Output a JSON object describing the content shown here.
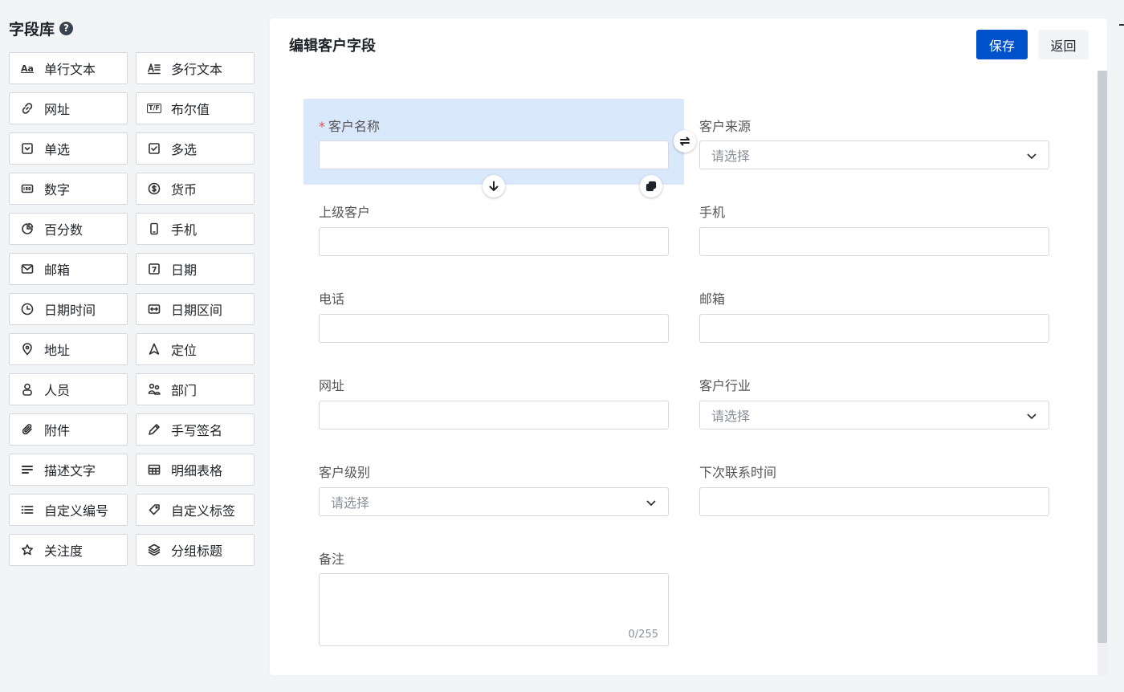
{
  "library": {
    "title": "字段库",
    "items": [
      {
        "label": "单行文本",
        "icon": "text-aa-icon"
      },
      {
        "label": "多行文本",
        "icon": "text-multiline-icon"
      },
      {
        "label": "网址",
        "icon": "link-icon"
      },
      {
        "label": "布尔值",
        "icon": "boolean-tf-icon"
      },
      {
        "label": "单选",
        "icon": "single-select-icon"
      },
      {
        "label": "多选",
        "icon": "multi-select-icon"
      },
      {
        "label": "数字",
        "icon": "number-100-icon"
      },
      {
        "label": "货币",
        "icon": "currency-dollar-icon"
      },
      {
        "label": "百分数",
        "icon": "pie-percent-icon"
      },
      {
        "label": "手机",
        "icon": "phone-icon"
      },
      {
        "label": "邮箱",
        "icon": "mail-icon"
      },
      {
        "label": "日期",
        "icon": "calendar-icon"
      },
      {
        "label": "日期时间",
        "icon": "clock-icon"
      },
      {
        "label": "日期区间",
        "icon": "date-range-icon"
      },
      {
        "label": "地址",
        "icon": "map-pin-icon"
      },
      {
        "label": "定位",
        "icon": "navigation-icon"
      },
      {
        "label": "人员",
        "icon": "person-icon"
      },
      {
        "label": "部门",
        "icon": "department-icon"
      },
      {
        "label": "附件",
        "icon": "paperclip-icon"
      },
      {
        "label": "手写签名",
        "icon": "pen-icon"
      },
      {
        "label": "描述文字",
        "icon": "text-lines-icon"
      },
      {
        "label": "明细表格",
        "icon": "table-icon"
      },
      {
        "label": "自定义编号",
        "icon": "list-number-icon"
      },
      {
        "label": "自定义标签",
        "icon": "tag-icon"
      },
      {
        "label": "关注度",
        "icon": "star-icon"
      },
      {
        "label": "分组标题",
        "icon": "layers-icon"
      }
    ]
  },
  "panel": {
    "title": "编辑客户字段",
    "save_label": "保存",
    "back_label": "返回"
  },
  "form": {
    "customer_name": {
      "label": "客户名称",
      "required_mark": "*",
      "value": ""
    },
    "customer_source": {
      "label": "客户来源",
      "placeholder": "请选择"
    },
    "parent_customer": {
      "label": "上级客户",
      "value": ""
    },
    "mobile": {
      "label": "手机",
      "value": ""
    },
    "phone": {
      "label": "电话",
      "value": ""
    },
    "email": {
      "label": "邮箱",
      "value": ""
    },
    "website": {
      "label": "网址",
      "value": ""
    },
    "industry": {
      "label": "客户行业",
      "placeholder": "请选择"
    },
    "level": {
      "label": "客户级别",
      "placeholder": "请选择"
    },
    "next_contact": {
      "label": "下次联系时间",
      "value": ""
    },
    "remark": {
      "label": "备注",
      "counter": "0/255"
    }
  },
  "colors": {
    "primary": "#0052cc",
    "highlight": "#dae8fb",
    "required": "#e34d59"
  }
}
